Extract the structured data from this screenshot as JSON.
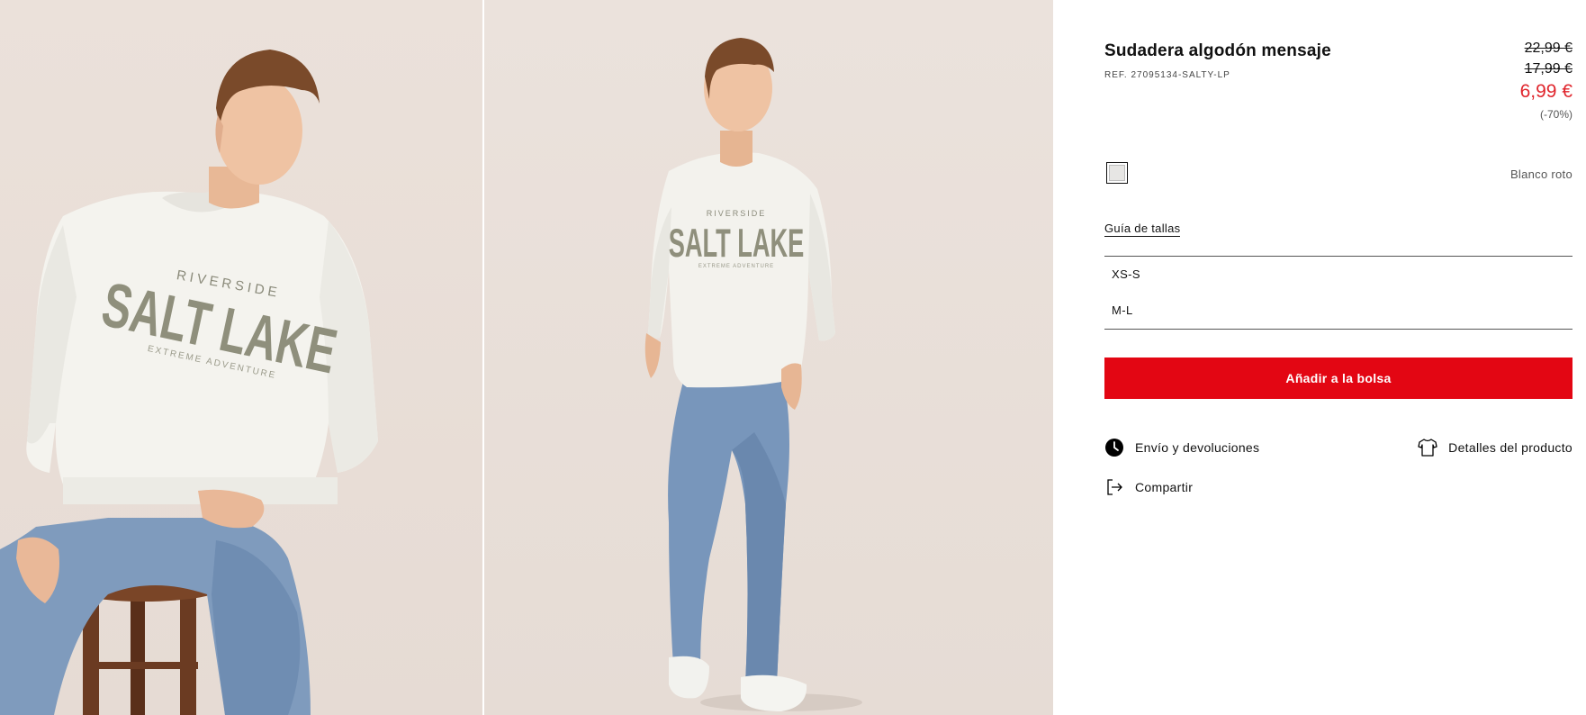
{
  "product": {
    "title": "Sudadera algodón mensaje",
    "ref": "REF. 27095134-SALTY-LP",
    "price_original": "22,99 €",
    "price_previous": "17,99 €",
    "price_current": "6,99 €",
    "discount": "(-70%)"
  },
  "colors": {
    "accent": "#e30613",
    "sale_price": "#e0262d",
    "swatch": "#e7e6e4"
  },
  "color_selector": {
    "selected_name": "Blanco roto"
  },
  "sizes": {
    "guide_label": "Guía de tallas",
    "options": [
      "XS-S",
      "M-L"
    ]
  },
  "actions": {
    "add_to_bag": "Añadir a la bolsa",
    "shipping_returns": "Envío y devoluciones",
    "product_details": "Detalles del producto",
    "share": "Compartir"
  },
  "gallery": {
    "sweatshirt_print": {
      "line1": "RIVERSIDE",
      "line2": "SALT LAKE",
      "line3": "EXTREME ADVENTURE"
    }
  }
}
